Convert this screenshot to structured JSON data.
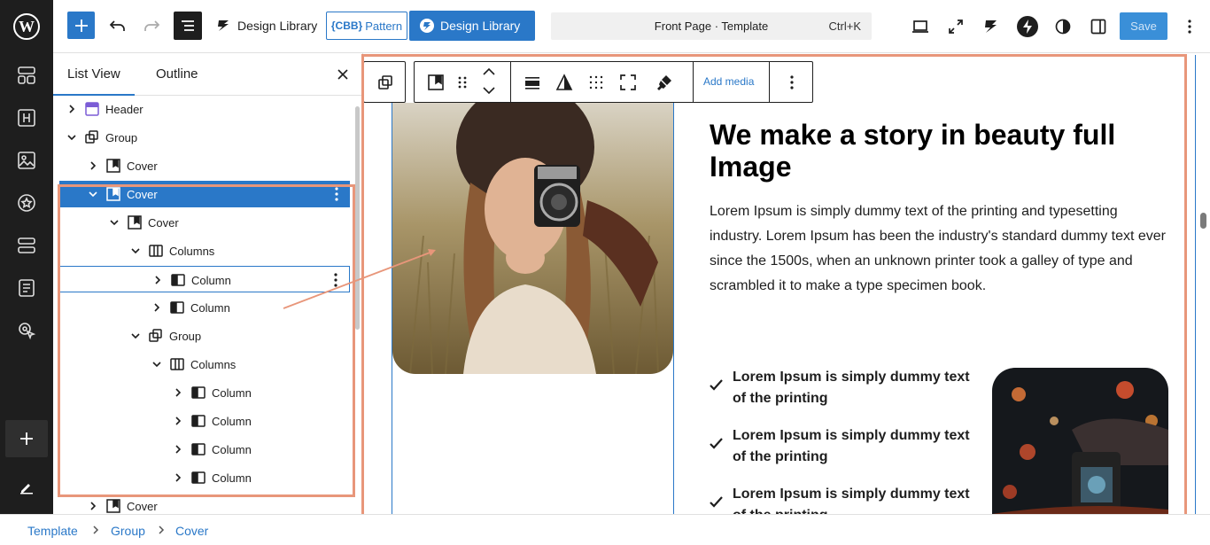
{
  "topbar": {
    "library_label": "Design Library",
    "pattern_label": "Pattern",
    "pattern_prefix": "{CBB}",
    "library_button_label": "Design Library",
    "command_title": "Front Page · Template",
    "command_shortcut": "Ctrl+K",
    "save_label": "Save"
  },
  "panel": {
    "tabs": [
      "List View",
      "Outline"
    ],
    "tree": [
      {
        "label": "Header",
        "icon": "template-part-icon",
        "chevron": "right"
      },
      {
        "label": "Group",
        "icon": "group-icon",
        "chevron": "down"
      },
      {
        "label": "Cover",
        "icon": "cover-icon",
        "chevron": "right"
      },
      {
        "label": "Cover",
        "icon": "cover-icon",
        "chevron": "down",
        "state": "selected"
      },
      {
        "label": "Cover",
        "icon": "cover-icon",
        "chevron": "down"
      },
      {
        "label": "Columns",
        "icon": "columns-icon",
        "chevron": "down"
      },
      {
        "label": "Column",
        "icon": "column-icon",
        "chevron": "right",
        "state": "hover"
      },
      {
        "label": "Column",
        "icon": "column-icon",
        "chevron": "right"
      },
      {
        "label": "Group",
        "icon": "group-icon",
        "chevron": "down"
      },
      {
        "label": "Columns",
        "icon": "columns-icon",
        "chevron": "down"
      },
      {
        "label": "Column",
        "icon": "column-icon",
        "chevron": "right"
      },
      {
        "label": "Column",
        "icon": "column-icon",
        "chevron": "right"
      },
      {
        "label": "Column",
        "icon": "column-icon",
        "chevron": "right"
      },
      {
        "label": "Column",
        "icon": "column-icon",
        "chevron": "right"
      },
      {
        "label": "Cover",
        "icon": "cover-icon",
        "chevron": "right"
      }
    ]
  },
  "block_toolbar": {
    "add_media_label": "Add media"
  },
  "content": {
    "headline": "We make a story in beauty full Image",
    "paragraph": "Lorem Ipsum is simply dummy text of the printing and typesetting industry. Lorem Ipsum has been the industry's standard dummy text ever since the 1500s, when an unknown printer took a galley of type and scrambled it to make a type specimen book.",
    "list_items": [
      "Lorem Ipsum is simply dummy text of the printing",
      "Lorem Ipsum is simply dummy text of the printing",
      "Lorem Ipsum is simply dummy text of the printing"
    ]
  },
  "breadcrumb": [
    "Template",
    "Group",
    "Cover"
  ],
  "colors": {
    "accent": "#2a78c8",
    "highlight": "#e8967a",
    "rail": "#1e1e1e"
  }
}
